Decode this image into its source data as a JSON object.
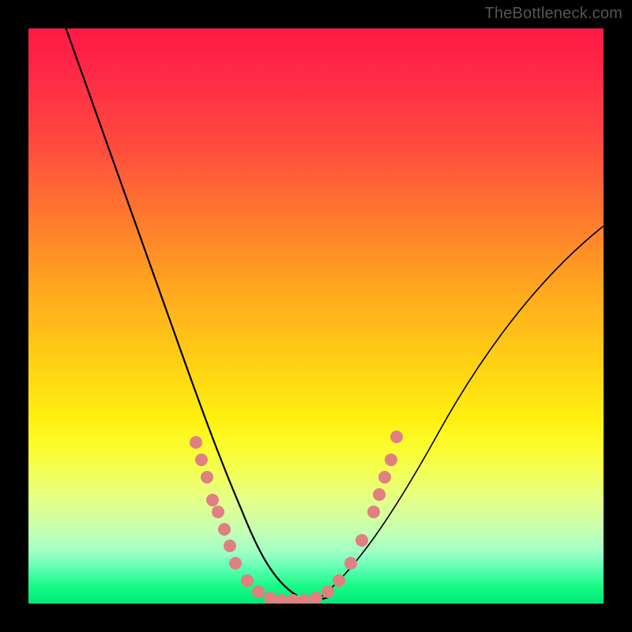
{
  "domain": "Chart",
  "watermark": "TheBottleneck.com",
  "colors": {
    "frame": "#000000",
    "curve": "#000000",
    "dot": "#e08080",
    "gradient_top": "#ff1a44",
    "gradient_mid": "#ffd014",
    "gradient_bottom": "#00e877"
  },
  "chart_data": {
    "type": "line",
    "title": "",
    "xlabel": "",
    "ylabel": "",
    "xlim": [
      0,
      100
    ],
    "ylim": [
      0,
      100
    ],
    "grid": false,
    "annotations": [],
    "legend": [],
    "series": [
      {
        "name": "left-curve",
        "x": [
          6,
          10,
          14,
          18,
          22,
          24,
          26,
          28,
          30,
          32,
          34,
          36,
          38,
          40
        ],
        "y": [
          100,
          85,
          71,
          58,
          46,
          40,
          34,
          28,
          22,
          16,
          10,
          6,
          3,
          1
        ]
      },
      {
        "name": "right-curve",
        "x": [
          52,
          56,
          60,
          64,
          68,
          72,
          76,
          80,
          84,
          88,
          92,
          96,
          100
        ],
        "y": [
          1,
          5,
          10,
          16,
          22,
          28,
          34,
          40,
          46,
          52,
          57,
          62,
          66
        ]
      },
      {
        "name": "valley-floor",
        "x": [
          40,
          44,
          48,
          52
        ],
        "y": [
          1,
          0,
          0,
          1
        ]
      }
    ],
    "scatter_points": {
      "name": "dots",
      "points": [
        {
          "x": 29,
          "y": 28
        },
        {
          "x": 30,
          "y": 25
        },
        {
          "x": 31,
          "y": 22
        },
        {
          "x": 32,
          "y": 18
        },
        {
          "x": 33,
          "y": 16
        },
        {
          "x": 34,
          "y": 13
        },
        {
          "x": 35,
          "y": 10
        },
        {
          "x": 36,
          "y": 7
        },
        {
          "x": 38,
          "y": 4
        },
        {
          "x": 40,
          "y": 2
        },
        {
          "x": 42,
          "y": 1
        },
        {
          "x": 44,
          "y": 0.5
        },
        {
          "x": 46,
          "y": 0.5
        },
        {
          "x": 48,
          "y": 0.5
        },
        {
          "x": 50,
          "y": 1
        },
        {
          "x": 52,
          "y": 2
        },
        {
          "x": 54,
          "y": 4
        },
        {
          "x": 56,
          "y": 7
        },
        {
          "x": 58,
          "y": 11
        },
        {
          "x": 60,
          "y": 16
        },
        {
          "x": 61,
          "y": 19
        },
        {
          "x": 62,
          "y": 22
        },
        {
          "x": 63,
          "y": 25
        },
        {
          "x": 64,
          "y": 29
        }
      ]
    }
  }
}
